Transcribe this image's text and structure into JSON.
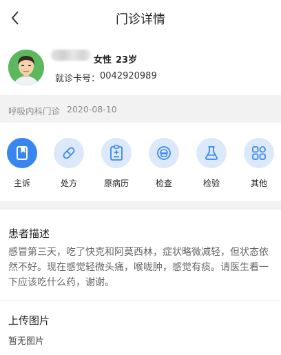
{
  "nav": {
    "title": "门诊详情",
    "back_icon": "chevron-left-icon"
  },
  "patient": {
    "gender": "女性",
    "age": "23岁",
    "card_label": "就诊卡号：",
    "card_number": "0042920989"
  },
  "visit": {
    "department": "呼吸内科门诊",
    "date": "2020-08-10"
  },
  "actions": [
    {
      "label": "主诉",
      "icon": "clipboard-icon",
      "active": true
    },
    {
      "label": "处方",
      "icon": "pill-icon",
      "active": false
    },
    {
      "label": "原病历",
      "icon": "medical-record-icon",
      "active": false
    },
    {
      "label": "检查",
      "icon": "examination-icon",
      "active": false
    },
    {
      "label": "检验",
      "icon": "flask-icon",
      "active": false
    },
    {
      "label": "其他",
      "icon": "grid-icon",
      "active": false
    }
  ],
  "description": {
    "heading": "患者描述",
    "text": "感冒第三天，吃了快克和阿莫西林，症状略微减轻，但状态依然不好。现在感觉轻微头痛，喉咙肿，感觉有痰。请医生看一下应该吃什么药，谢谢。"
  },
  "upload": {
    "heading": "上传图片",
    "empty_text": "暂无图片"
  },
  "colors": {
    "accent": "#3a86f0",
    "icon_bg": "#dce9fb",
    "avatar_bg": "#5cb85c",
    "section_bg": "#f2f2f2"
  }
}
